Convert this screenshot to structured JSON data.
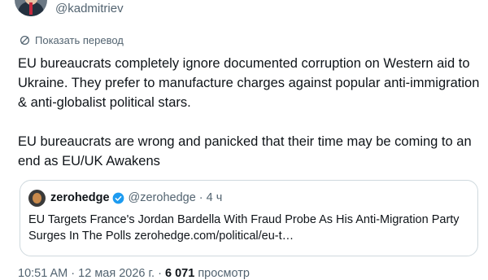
{
  "author": {
    "handle": "@kadmitriev"
  },
  "translate_link": "Показать перевод",
  "tweet": {
    "paragraphs": [
      "EU bureaucrats completely ignore documented corruption on Western aid to Ukraine. They prefer to manufacture charges against popular anti-immigration & anti-globalist political stars.",
      "EU bureaucrats are wrong and panicked that their time may be coming to an end as EU/UK Awakens"
    ]
  },
  "quote": {
    "name": "zerohedge",
    "handle": "@zerohedge",
    "separator": "·",
    "time": "4 ч",
    "text": "EU Targets France's Jordan Bardella With Fraud Probe As His Anti-Migration Party Surges In The Polls zerohedge.com/political/eu-t…"
  },
  "footer": {
    "time": "10:51 AM",
    "date": "12 мая 2026 г.",
    "separator": "·",
    "views": "6 071",
    "views_label": "просмотр"
  },
  "colors": {
    "verified": "#1d9bf0",
    "secondary_text": "#536471",
    "border": "#cfd9de"
  },
  "icons": {
    "translate": "globe-icon",
    "verified": "verified-badge-icon"
  }
}
